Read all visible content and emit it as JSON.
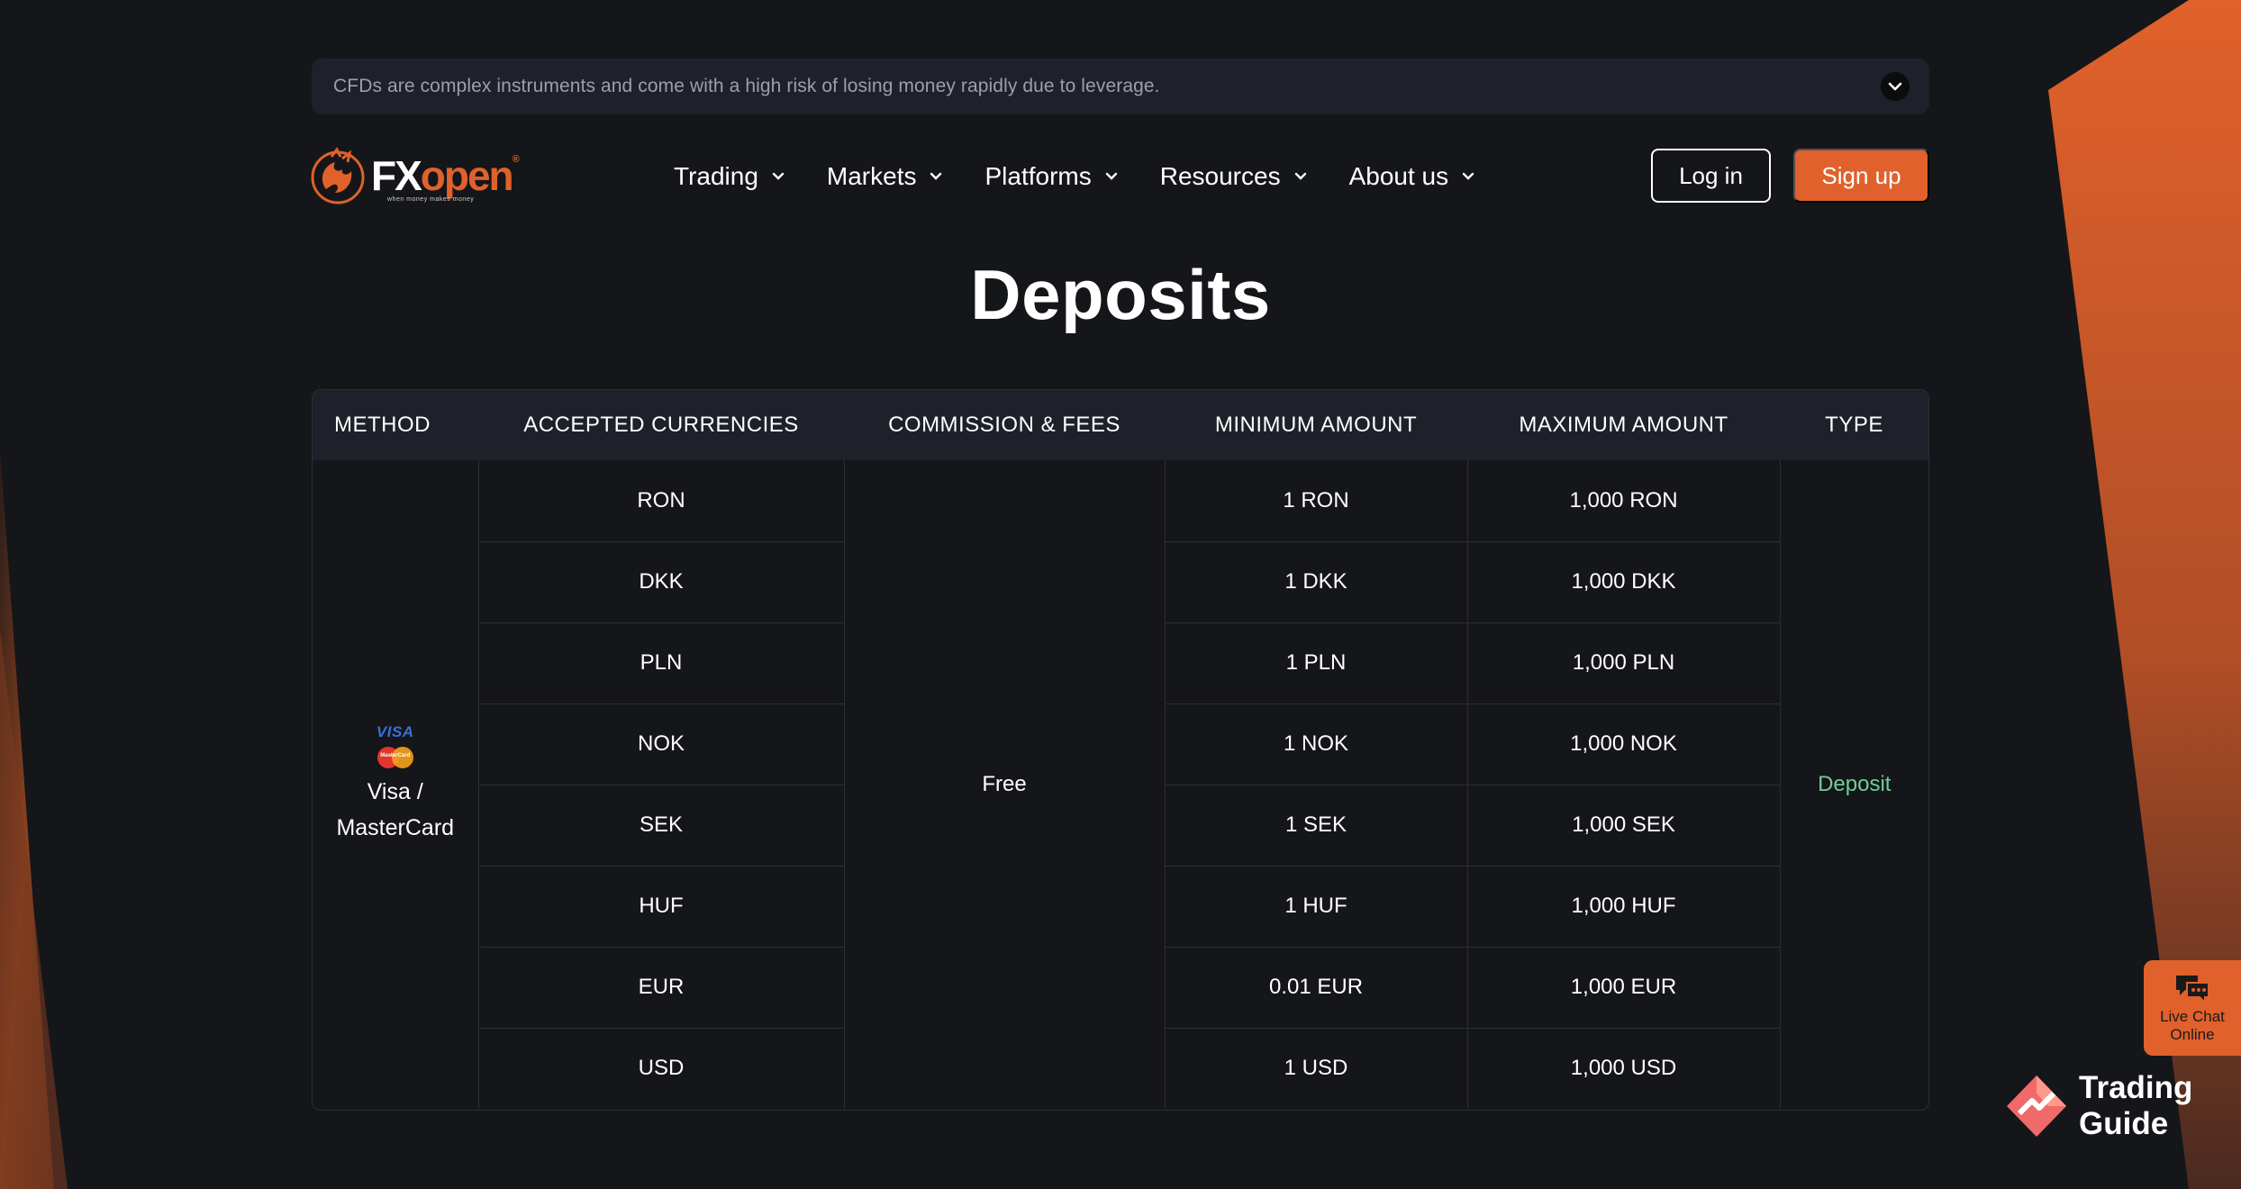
{
  "risk_banner": {
    "text": "CFDs are complex instruments and come with a high risk of losing money rapidly due to leverage."
  },
  "logo": {
    "brand_fx": "FX",
    "brand_open": "open",
    "tagline": "when money makes money",
    "registered": "®"
  },
  "nav": {
    "items": [
      {
        "label": "Trading"
      },
      {
        "label": "Markets"
      },
      {
        "label": "Platforms"
      },
      {
        "label": "Resources"
      },
      {
        "label": "About us"
      }
    ],
    "login_label": "Log in",
    "signup_label": "Sign up"
  },
  "page": {
    "title": "Deposits"
  },
  "table": {
    "headers": [
      "METHOD",
      "ACCEPTED CURRENCIES",
      "COMMISSION & FEES",
      "MINIMUM AMOUNT",
      "MAXIMUM AMOUNT",
      "TYPE"
    ],
    "method": {
      "visa_text": "VISA",
      "mastercard_text": "MasterCard",
      "label_line1": "Visa /",
      "label_line2": "MasterCard"
    },
    "commission": "Free",
    "type": "Deposit",
    "rows": [
      {
        "currency": "RON",
        "min": "1 RON",
        "max": "1,000 RON"
      },
      {
        "currency": "DKK",
        "min": "1 DKK",
        "max": "1,000 DKK"
      },
      {
        "currency": "PLN",
        "min": "1 PLN",
        "max": "1,000 PLN"
      },
      {
        "currency": "NOK",
        "min": "1 NOK",
        "max": "1,000 NOK"
      },
      {
        "currency": "SEK",
        "min": "1 SEK",
        "max": "1,000 SEK"
      },
      {
        "currency": "HUF",
        "min": "1 HUF",
        "max": "1,000 HUF"
      },
      {
        "currency": "EUR",
        "min": "0.01 EUR",
        "max": "1,000 EUR"
      },
      {
        "currency": "USD",
        "min": "1 USD",
        "max": "1,000 USD"
      }
    ]
  },
  "live_chat": {
    "line1": "Live Chat",
    "line2": "Online",
    "icon": "chat-bubbles-icon"
  },
  "watermark": {
    "line1": "Trading",
    "line2": "Guide"
  },
  "colors": {
    "background": "#151619",
    "accent": "#e0612b",
    "banner": "#1e2129",
    "deposit_type": "#6fcf97"
  }
}
